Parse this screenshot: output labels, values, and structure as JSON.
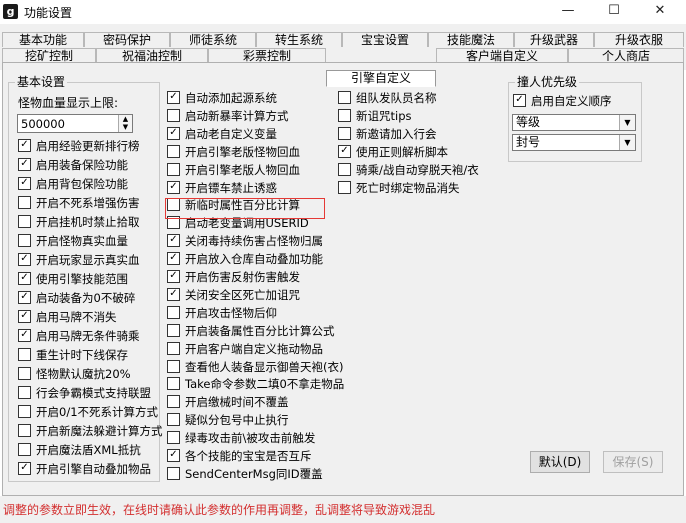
{
  "window": {
    "title": "功能设置",
    "app_icon_glyph": "g",
    "minimize": "—",
    "maximize": "☐",
    "close": "✕"
  },
  "tabs": {
    "row1": [
      "基本功能",
      "密码保护",
      "师徒系统",
      "转生系统",
      "宝宝设置",
      "技能魔法",
      "升级武器",
      "升级衣服"
    ],
    "row2": [
      "挖矿控制",
      "祝福油控制",
      "彩票控制",
      "引擎自定义",
      "客户端自定义",
      "个人商店"
    ],
    "active": "引擎自定义"
  },
  "basic": {
    "group_title": "基本设置",
    "hp_label": "怪物血量显示上限:",
    "hp_value": "500000",
    "items": [
      {
        "label": "启用经验更新排行榜",
        "checked": true
      },
      {
        "label": "启用装备保险功能",
        "checked": true
      },
      {
        "label": "启用背包保险功能",
        "checked": true
      },
      {
        "label": "开启不死系增强伤害",
        "checked": false
      },
      {
        "label": "开启挂机时禁止拾取",
        "checked": false
      },
      {
        "label": "开启怪物真实血量",
        "checked": false
      },
      {
        "label": "开启玩家显示真实血",
        "checked": true
      },
      {
        "label": "使用引擎技能范围",
        "checked": true
      },
      {
        "label": "启动装备为0不破碎",
        "checked": true
      },
      {
        "label": "启用马牌不消失",
        "checked": true
      },
      {
        "label": "启用马牌无条件骑乘",
        "checked": true
      },
      {
        "label": "重生计时下线保存",
        "checked": false
      },
      {
        "label": "怪物默认魔抗20%",
        "checked": false
      },
      {
        "label": "行会争霸模式支持联盟",
        "checked": false
      },
      {
        "label": "开启0/1不死系计算方式",
        "checked": false
      },
      {
        "label": "开启新魔法躲避计算方式",
        "checked": false
      },
      {
        "label": "开启魔法盾XML抵抗",
        "checked": false
      },
      {
        "label": "开启引擎自动叠加物品",
        "checked": true
      }
    ]
  },
  "col2": {
    "items": [
      {
        "label": "自动添加起源系统",
        "checked": true
      },
      {
        "label": "启动新暴率计算方式",
        "checked": false
      },
      {
        "label": "启动老自定义变量",
        "checked": true
      },
      {
        "label": "开启引擎老版怪物回血",
        "checked": false
      },
      {
        "label": "开启引擎老版人物回血",
        "checked": false
      },
      {
        "label": "开启镖车禁止诱惑",
        "checked": true
      },
      {
        "label": "新临时属性百分比计算",
        "checked": false
      },
      {
        "label": "启动老变量调用USERID",
        "checked": false
      },
      {
        "label": "关闭毒持续伤害占怪物归属",
        "checked": true
      },
      {
        "label": "开启放入仓库自动叠加功能",
        "checked": true
      },
      {
        "label": "开启伤害反射伤害触发",
        "checked": true
      },
      {
        "label": "关闭安全区死亡加诅咒",
        "checked": true
      },
      {
        "label": "开启攻击怪物后仰",
        "checked": false
      },
      {
        "label": "开启装备属性百分比计算公式",
        "checked": false
      },
      {
        "label": "开启客户端自定义拖动物品",
        "checked": false
      },
      {
        "label": "查看他人装备显示御兽天袍(衣)",
        "checked": false
      },
      {
        "label": "Take命令参数二填0不拿走物品",
        "checked": false
      },
      {
        "label": "开启缴械时间不覆盖",
        "checked": false
      },
      {
        "label": "疑似分包号中止执行",
        "checked": false
      },
      {
        "label": "绿毒攻击前\\被攻击前触发",
        "checked": false
      },
      {
        "label": "各个技能的宝宝是否互斥",
        "checked": true
      },
      {
        "label": "SendCenterMsg同ID覆盖",
        "checked": false
      }
    ]
  },
  "col3": {
    "items": [
      {
        "label": "组队发队员名称",
        "checked": false
      },
      {
        "label": "新诅咒tips",
        "checked": false
      },
      {
        "label": "新邀请加入行会",
        "checked": false
      },
      {
        "label": "使用正则解析脚本",
        "checked": true
      },
      {
        "label": "骑乘/战自动穿脱天袍/衣",
        "checked": false
      },
      {
        "label": "死亡时绑定物品消失",
        "checked": false
      }
    ]
  },
  "collision": {
    "group_title": "撞人优先级",
    "enable_label": "启用自定义顺序",
    "enable_checked": true,
    "select1": "等级",
    "select2": "封号"
  },
  "buttons": {
    "default": "默认(D)",
    "save": "保存(S)"
  },
  "footer": {
    "warning": "调整的参数立即生效，在线时请确认此参数的作用再调整，乱调整将导致游戏混乱",
    "warning_color": "#d32f2f"
  },
  "colors": {
    "highlight_border": "#e53935"
  }
}
